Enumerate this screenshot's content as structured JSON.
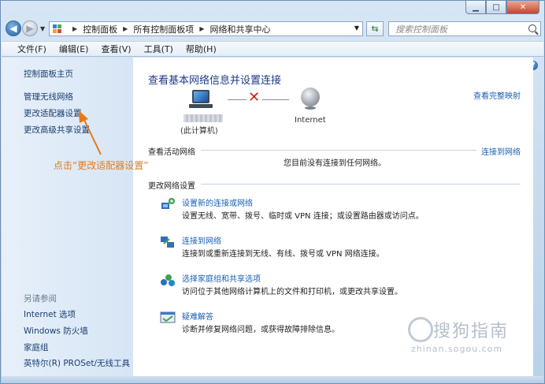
{
  "window": {
    "caption_buttons": [
      "minimize",
      "maximize",
      "close"
    ]
  },
  "address_bar": {
    "breadcrumbs": [
      "控制面板",
      "所有控制面板项",
      "网络和共享中心"
    ],
    "search_placeholder": "搜索控制面板"
  },
  "menu": {
    "items": [
      "文件(F)",
      "编辑(E)",
      "查看(V)",
      "工具(T)",
      "帮助(H)"
    ]
  },
  "left_pane": {
    "home": "控制面板主页",
    "links": [
      "管理无线网络",
      "更改适配器设置",
      "更改高级共享设置"
    ],
    "see_also_heading": "另请参阅",
    "see_also": [
      "Internet 选项",
      "Windows 防火墙",
      "家庭组",
      "英特尔(R) PROSet/无线工具"
    ]
  },
  "main": {
    "title": "查看基本网络信息并设置连接",
    "view_full_map": "查看完整映射",
    "computer_caption": "(此计算机)",
    "internet_caption": "Internet",
    "active_networks_heading": "查看活动网络",
    "connect_to_network": "连接到网络",
    "no_network_text": "您目前没有连接到任何网络。",
    "change_settings_heading": "更改网络设置",
    "tasks": [
      {
        "link": "设置新的连接或网络",
        "desc": "设置无线、宽带、拨号、临时或 VPN 连接；或设置路由器或访问点。",
        "icon": "new-connection-icon"
      },
      {
        "link": "连接到网络",
        "desc": "连接到或重新连接到无线、有线、拨号或 VPN 网络连接。",
        "icon": "connect-network-icon"
      },
      {
        "link": "选择家庭组和共享选项",
        "desc": "访问位于其他网络计算机上的文件和打印机，或更改共享设置。",
        "icon": "homegroup-icon"
      },
      {
        "link": "疑难解答",
        "desc": "诊断并修复网络问题，或获得故障排除信息。",
        "icon": "troubleshoot-icon"
      }
    ]
  },
  "annotation": {
    "text": "点击“更改适配器设置”",
    "color": "#e67a18"
  },
  "watermark": {
    "text": "搜狗指南",
    "url": "zhinan.sogou.com"
  }
}
